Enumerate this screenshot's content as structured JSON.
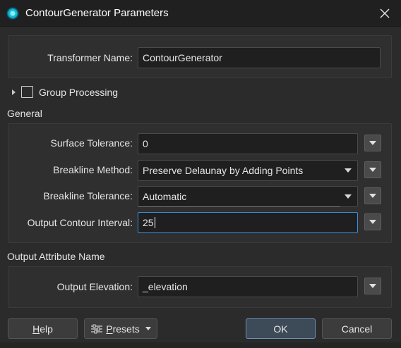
{
  "window": {
    "title": "ContourGenerator Parameters"
  },
  "transformer": {
    "name_label": "Transformer Name:",
    "name_value": "ContourGenerator"
  },
  "group_processing": {
    "label": "Group Processing",
    "checked": false
  },
  "general": {
    "section_title": "General",
    "surface_tolerance": {
      "label": "Surface Tolerance:",
      "value": "0"
    },
    "breakline_method": {
      "label": "Breakline Method:",
      "value": "Preserve Delaunay by Adding Points"
    },
    "breakline_tolerance": {
      "label": "Breakline Tolerance:",
      "value": "Automatic"
    },
    "output_contour_interval": {
      "label": "Output Contour Interval:",
      "value": "25"
    }
  },
  "output_attribute": {
    "section_title": "Output Attribute Name",
    "output_elevation": {
      "label": "Output Elevation:",
      "value": "_elevation"
    }
  },
  "buttons": {
    "help": "Help",
    "presets": "Presets",
    "ok": "OK",
    "cancel": "Cancel"
  }
}
